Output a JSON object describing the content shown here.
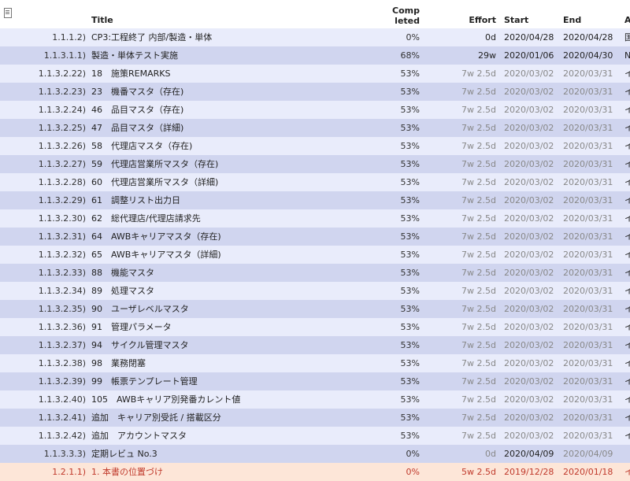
{
  "header": {
    "title": "Title",
    "completed_line1": "Comp",
    "completed_line2": "leted",
    "effort": "Effort",
    "start": "Start",
    "end": "End",
    "assignee": "A"
  },
  "rows": [
    {
      "id": "1.1.1.2)",
      "title": "CP3:工程終了 内部/製造・単体",
      "completed": "0%",
      "effort": "0d",
      "start": "2020/04/28",
      "end": "2020/04/28",
      "assignee": "国"
    },
    {
      "id": "1.1.3.1.1)",
      "title": "製造・単体テスト実施",
      "completed": "68%",
      "effort": "29w",
      "start": "2020/01/06",
      "end": "2020/04/30",
      "assignee": "N"
    },
    {
      "id": "1.1.3.2.22)",
      "title": "18　施策REMARKS",
      "completed": "53%",
      "effort": "7w 2.5d",
      "start": "2020/03/02",
      "end": "2020/03/31",
      "assignee": "イ"
    },
    {
      "id": "1.1.3.2.23)",
      "title": "23　機番マスタ（存在)",
      "completed": "53%",
      "effort": "7w 2.5d",
      "start": "2020/03/02",
      "end": "2020/03/31",
      "assignee": "イ"
    },
    {
      "id": "1.1.3.2.24)",
      "title": "46　品目マスタ（存在)",
      "completed": "53%",
      "effort": "7w 2.5d",
      "start": "2020/03/02",
      "end": "2020/03/31",
      "assignee": "イ"
    },
    {
      "id": "1.1.3.2.25)",
      "title": "47　品目マスタ（詳細)",
      "completed": "53%",
      "effort": "7w 2.5d",
      "start": "2020/03/02",
      "end": "2020/03/31",
      "assignee": "イ"
    },
    {
      "id": "1.1.3.2.26)",
      "title": "58　代理店マスタ（存在)",
      "completed": "53%",
      "effort": "7w 2.5d",
      "start": "2020/03/02",
      "end": "2020/03/31",
      "assignee": "イ"
    },
    {
      "id": "1.1.3.2.27)",
      "title": "59　代理店営業所マスタ（存在)",
      "completed": "53%",
      "effort": "7w 2.5d",
      "start": "2020/03/02",
      "end": "2020/03/31",
      "assignee": "イ"
    },
    {
      "id": "1.1.3.2.28)",
      "title": "60　代理店営業所マスタ（詳細)",
      "completed": "53%",
      "effort": "7w 2.5d",
      "start": "2020/03/02",
      "end": "2020/03/31",
      "assignee": "イ"
    },
    {
      "id": "1.1.3.2.29)",
      "title": "61　調整リスト出力日",
      "completed": "53%",
      "effort": "7w 2.5d",
      "start": "2020/03/02",
      "end": "2020/03/31",
      "assignee": "イ"
    },
    {
      "id": "1.1.3.2.30)",
      "title": "62　総代理店/代理店請求先",
      "completed": "53%",
      "effort": "7w 2.5d",
      "start": "2020/03/02",
      "end": "2020/03/31",
      "assignee": "イ"
    },
    {
      "id": "1.1.3.2.31)",
      "title": "64　AWBキャリアマスタ（存在)",
      "completed": "53%",
      "effort": "7w 2.5d",
      "start": "2020/03/02",
      "end": "2020/03/31",
      "assignee": "イ"
    },
    {
      "id": "1.1.3.2.32)",
      "title": "65　AWBキャリアマスタ（詳細)",
      "completed": "53%",
      "effort": "7w 2.5d",
      "start": "2020/03/02",
      "end": "2020/03/31",
      "assignee": "イ"
    },
    {
      "id": "1.1.3.2.33)",
      "title": "88　機能マスタ",
      "completed": "53%",
      "effort": "7w 2.5d",
      "start": "2020/03/02",
      "end": "2020/03/31",
      "assignee": "イ"
    },
    {
      "id": "1.1.3.2.34)",
      "title": "89　処理マスタ",
      "completed": "53%",
      "effort": "7w 2.5d",
      "start": "2020/03/02",
      "end": "2020/03/31",
      "assignee": "イ"
    },
    {
      "id": "1.1.3.2.35)",
      "title": "90　ユーザレベルマスタ",
      "completed": "53%",
      "effort": "7w 2.5d",
      "start": "2020/03/02",
      "end": "2020/03/31",
      "assignee": "イ"
    },
    {
      "id": "1.1.3.2.36)",
      "title": "91　管理パラメータ",
      "completed": "53%",
      "effort": "7w 2.5d",
      "start": "2020/03/02",
      "end": "2020/03/31",
      "assignee": "イ"
    },
    {
      "id": "1.1.3.2.37)",
      "title": "94　サイクル管理マスタ",
      "completed": "53%",
      "effort": "7w 2.5d",
      "start": "2020/03/02",
      "end": "2020/03/31",
      "assignee": "イ"
    },
    {
      "id": "1.1.3.2.38)",
      "title": "98　業務閉塞",
      "completed": "53%",
      "effort": "7w 2.5d",
      "start": "2020/03/02",
      "end": "2020/03/31",
      "assignee": "イ"
    },
    {
      "id": "1.1.3.2.39)",
      "title": "99　帳票テンプレート管理",
      "completed": "53%",
      "effort": "7w 2.5d",
      "start": "2020/03/02",
      "end": "2020/03/31",
      "assignee": "イ"
    },
    {
      "id": "1.1.3.2.40)",
      "title": "105　AWBキャリア別発番カレント値",
      "completed": "53%",
      "effort": "7w 2.5d",
      "start": "2020/03/02",
      "end": "2020/03/31",
      "assignee": "イ"
    },
    {
      "id": "1.1.3.2.41)",
      "title": "追加　キャリア別受託 / 搭載区分",
      "completed": "53%",
      "effort": "7w 2.5d",
      "start": "2020/03/02",
      "end": "2020/03/31",
      "assignee": "イ"
    },
    {
      "id": "1.1.3.2.42)",
      "title": "追加　アカウントマスタ",
      "completed": "53%",
      "effort": "7w 2.5d",
      "start": "2020/03/02",
      "end": "2020/03/31",
      "assignee": "イ"
    },
    {
      "id": "1.1.3.3.3)",
      "title": "定期レビュ No.3",
      "completed": "0%",
      "effort": "0d",
      "start": "2020/04/09",
      "end": "2020/04/09",
      "assignee": ""
    },
    {
      "id": "1.2.1.1)",
      "title": "1. 本書の位置づけ",
      "completed": "0%",
      "effort": "5w 2.5d",
      "start": "2019/12/28",
      "end": "2020/01/18",
      "assignee": "イ"
    }
  ]
}
